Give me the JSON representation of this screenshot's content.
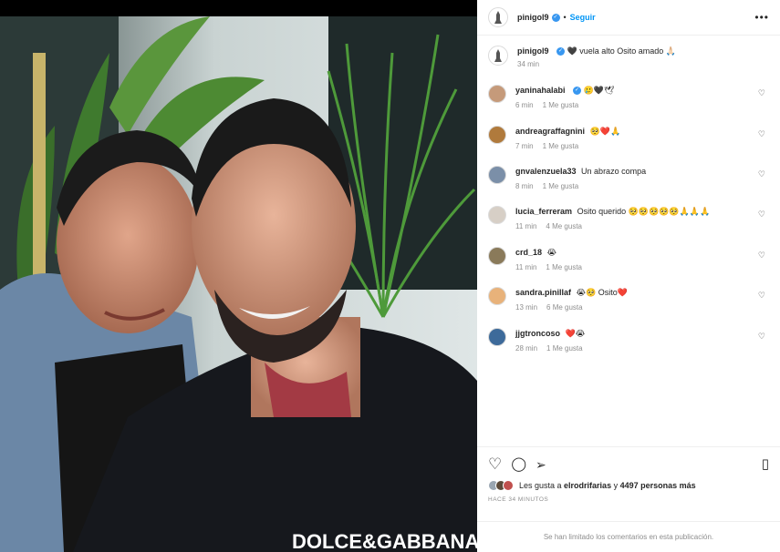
{
  "post": {
    "author": "pinigol9",
    "follow_label": "Seguir",
    "dot": "•",
    "more": "•••",
    "verified_mark": "✓"
  },
  "caption": {
    "user": "pinigol9",
    "text": "🖤 vuela alto Osito amado 🙏🏻",
    "time": "34 min"
  },
  "comments": [
    {
      "user": "yaninahalabi",
      "verified": true,
      "text": "🥲🖤🕊",
      "time": "6 min",
      "likes": "1 Me gusta"
    },
    {
      "user": "andreagraffagnini",
      "verified": false,
      "text": "🥺❤️🙏",
      "time": "7 min",
      "likes": "1 Me gusta"
    },
    {
      "user": "gnvalenzuela33",
      "verified": false,
      "text": "Un abrazo compa",
      "time": "8 min",
      "likes": "1 Me gusta"
    },
    {
      "user": "lucia_ferreram",
      "verified": false,
      "text": "Osito querido 🥺🥺🥺🥺🥺🙏🙏🙏",
      "time": "11 min",
      "likes": "4 Me gusta"
    },
    {
      "user": "crd_18",
      "verified": false,
      "text": "😭",
      "time": "11 min",
      "likes": "1 Me gusta"
    },
    {
      "user": "sandra.pinillaf",
      "verified": false,
      "text": "😭🥺 Osito❤️",
      "time": "13 min",
      "likes": "6 Me gusta"
    },
    {
      "user": "jjgtroncoso",
      "verified": false,
      "text": "❤️😭",
      "time": "28 min",
      "likes": "1 Me gusta"
    }
  ],
  "actions": {
    "heart": "♡",
    "comment": "◯",
    "share": "➢",
    "bookmark": "▯"
  },
  "likes": {
    "prefix": "Les gusta a ",
    "user": "elrodrifarias",
    "middle": " y ",
    "count": "4497 personas más"
  },
  "time_ago": "HACE 34 MINUTOS",
  "footer": "Se han limitado los comentarios en esta publicación.",
  "colors": {
    "accent": "#0095f6",
    "verified": "#3897f0",
    "muted": "#8e8e8e"
  }
}
